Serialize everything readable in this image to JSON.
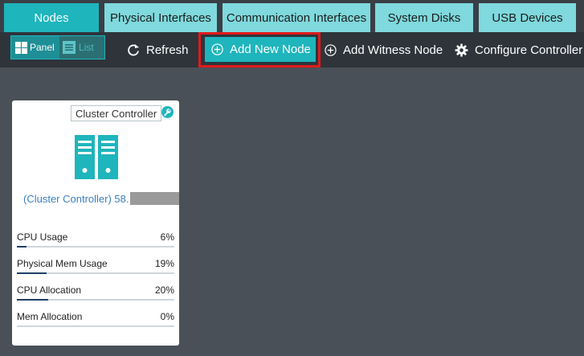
{
  "tabs": [
    {
      "label": "Nodes",
      "active": true
    },
    {
      "label": "Physical Interfaces",
      "active": false
    },
    {
      "label": "Communication Interfaces",
      "active": false
    },
    {
      "label": "System Disks",
      "active": false
    },
    {
      "label": "USB Devices",
      "active": false
    }
  ],
  "toolbar": {
    "view_toggle": {
      "panel_label": "Panel",
      "list_label": "List",
      "selected": "Panel"
    },
    "refresh_label": "Refresh",
    "add_new_node_label": "Add New Node",
    "add_witness_node_label": "Add Witness Node",
    "configure_controller_label": "Configure Controller N"
  },
  "node_card": {
    "role_badge": "Cluster Controller",
    "name": "(Cluster Controller) 58.",
    "metrics": [
      {
        "label": "CPU Usage",
        "value": "6%",
        "fraction": 0.06
      },
      {
        "label": "Physical Mem Usage",
        "value": "19%",
        "fraction": 0.19
      },
      {
        "label": "CPU Allocation",
        "value": "20%",
        "fraction": 0.2
      },
      {
        "label": "Mem Allocation",
        "value": "0%",
        "fraction": 0.0
      }
    ]
  },
  "colors": {
    "accent": "#1fb5bc",
    "tab_inactive": "#7fd9dd",
    "highlight_outline": "#e01b1b",
    "link": "#3b7fbf",
    "bar_fill": "#1f3f66"
  }
}
